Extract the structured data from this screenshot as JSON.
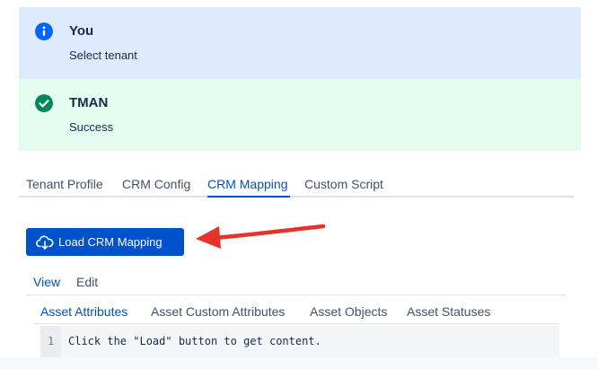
{
  "flags": {
    "info": {
      "title": "You",
      "description": "Select tenant",
      "icon": "info-icon",
      "color": "#0065ff"
    },
    "success": {
      "title": "TMAN",
      "description": "Success",
      "icon": "check-circle-icon",
      "color": "#00875a"
    }
  },
  "main_tabs": [
    {
      "label": "Tenant Profile"
    },
    {
      "label": "CRM Config"
    },
    {
      "label": "CRM Mapping",
      "active": true
    },
    {
      "label": "Custom Script"
    }
  ],
  "load_button": {
    "label": "Load CRM Mapping",
    "icon": "cloud-download-icon",
    "color": "#0052cc"
  },
  "annotation": {
    "icon": "red-arrow-icon",
    "color": "#e5332a"
  },
  "view_tabs": [
    {
      "label": "View",
      "active": true
    },
    {
      "label": "Edit"
    }
  ],
  "sub_tabs": [
    {
      "label": "Asset Attributes",
      "active": true
    },
    {
      "label": "Asset Custom Attributes"
    },
    {
      "label": "Asset Objects"
    },
    {
      "label": "Asset Statuses"
    }
  ],
  "code": {
    "line_number": "1",
    "text": "Click the \"Load\" button to get content."
  }
}
